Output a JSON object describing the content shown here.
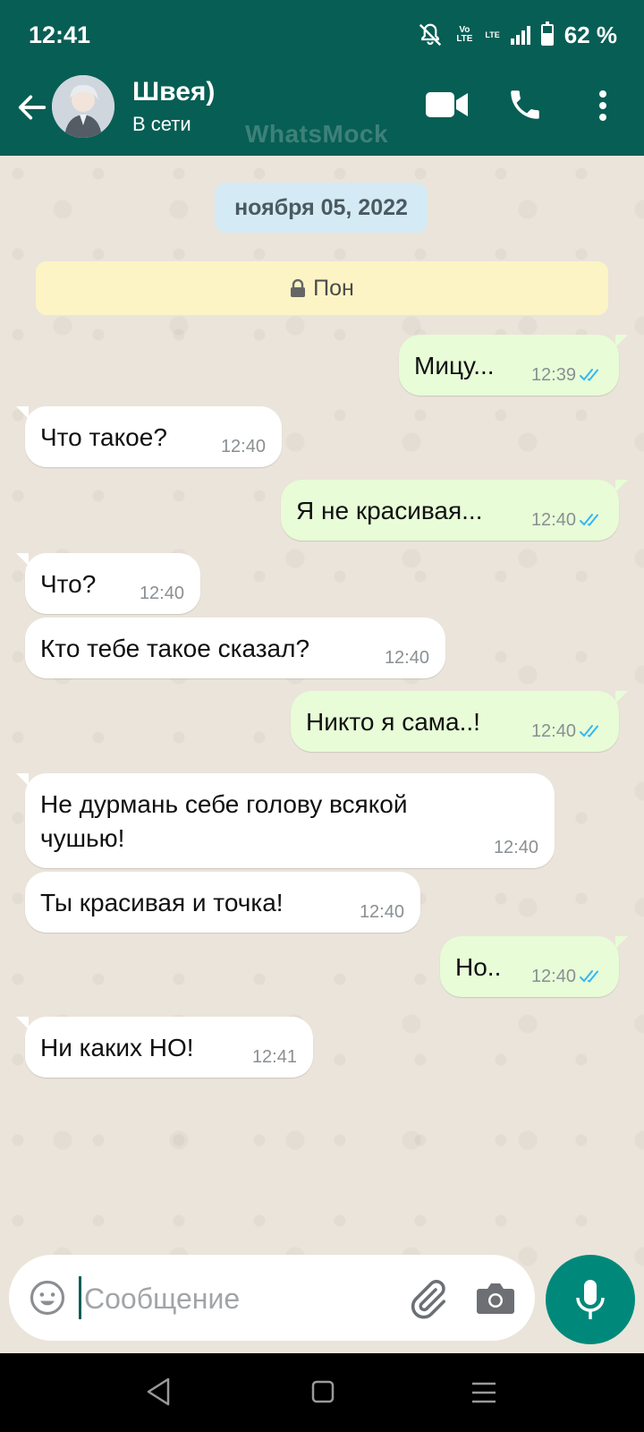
{
  "status_bar": {
    "time": "12:41",
    "volte_label": "Vo LTE",
    "lte_label": "LTE",
    "battery_text": "62 %",
    "battery_level": 0.62
  },
  "header": {
    "contact_name": "Швея)",
    "contact_status": "В сети",
    "watermark": "WhatsMock"
  },
  "chat": {
    "date_chip": "ноября 05, 2022",
    "encryption_banner": "Пон",
    "messages": [
      {
        "dir": "out",
        "text": "Мицу...",
        "time": "12:39",
        "read": true
      },
      {
        "dir": "in",
        "text": "Что такое?",
        "time": "12:40"
      },
      {
        "dir": "out",
        "text": "Я не красивая...",
        "time": "12:40",
        "read": true
      },
      {
        "dir": "in",
        "text": "Что?",
        "time": "12:40"
      },
      {
        "dir": "in",
        "text": "Кто тебе такое сказал?",
        "time": "12:40"
      },
      {
        "dir": "out",
        "text": "Никто я сама..!",
        "time": "12:40",
        "read": true
      },
      {
        "dir": "in",
        "text": "Не дурмань себе голову всякой чушью!",
        "time": "12:40"
      },
      {
        "dir": "in",
        "text": "Ты красивая и точка!",
        "time": "12:40"
      },
      {
        "dir": "out",
        "text": "Но..",
        "time": "12:40",
        "read": true
      },
      {
        "dir": "in",
        "text": "Ни каких НО!",
        "time": "12:41"
      }
    ]
  },
  "composer": {
    "placeholder": "Сообщение",
    "value": ""
  },
  "colors": {
    "header": "#075e54",
    "incoming_bubble": "#ffffff",
    "outgoing_bubble": "#e7fcd7",
    "read_ticks": "#34b7f1",
    "mic_button": "#00897b"
  },
  "icons": {
    "back": "arrow-left-icon",
    "video": "video-camera-icon",
    "call": "phone-icon",
    "menu": "three-dots-vertical-icon",
    "emoji": "smiley-icon",
    "attach": "paperclip-icon",
    "camera": "camera-icon",
    "mic": "microphone-icon"
  }
}
